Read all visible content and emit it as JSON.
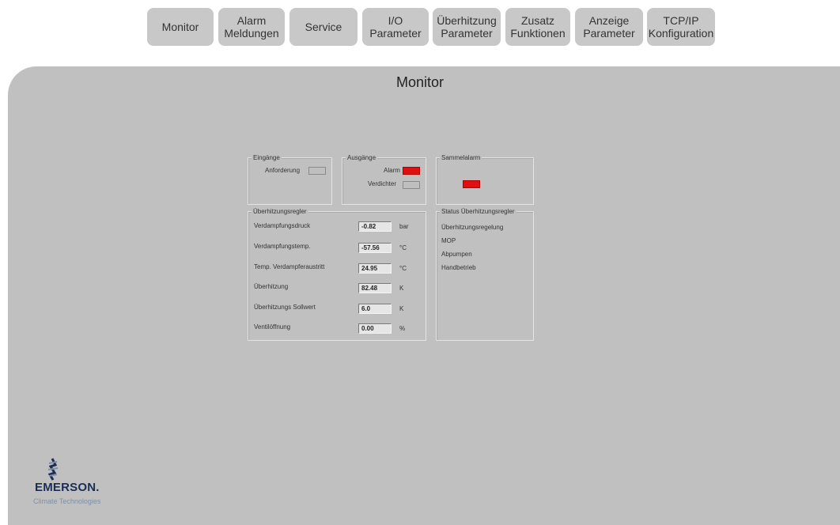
{
  "tabs": [
    {
      "label": "Monitor"
    },
    {
      "label": "Alarm\nMeldungen"
    },
    {
      "label": "Service"
    },
    {
      "label": "I/O\nParameter"
    },
    {
      "label": "Überhitzung\nParameter"
    },
    {
      "label": "Zusatz\nFunktionen"
    },
    {
      "label": "Anzeige\nParameter"
    },
    {
      "label": "TCP/IP\nKonfiguration"
    }
  ],
  "page": {
    "title": "Monitor"
  },
  "eingaenge": {
    "title": "Eingänge",
    "anforderung_label": "Anforderung",
    "anforderung_active": false
  },
  "ausgaenge": {
    "title": "Ausgänge",
    "alarm_label": "Alarm",
    "alarm_active": true,
    "verdichter_label": "Verdichter",
    "verdichter_active": false
  },
  "sammelalarm": {
    "title": "Sammelalarm",
    "active": true
  },
  "regler": {
    "title": "Überhitzungsregler",
    "rows": [
      {
        "label": "Verdampfungsdruck",
        "value": "-0.82",
        "unit": "bar"
      },
      {
        "label": "Verdampfungstemp.",
        "value": "-57.56",
        "unit": "°C"
      },
      {
        "label": "Temp. Verdampferaustritt",
        "value": "24.95",
        "unit": "°C"
      },
      {
        "label": "Überhitzung",
        "value": "82.48",
        "unit": "K"
      },
      {
        "label": "Überhitzungs Sollwert",
        "value": "6.0",
        "unit": "K"
      },
      {
        "label": "Ventilöffnung",
        "value": "0.00",
        "unit": "%"
      }
    ]
  },
  "status": {
    "title": "Status Überhitzungsregler",
    "items": [
      "Überhitzungsregelung",
      "MOP",
      "Abpumpen",
      "Handbetrieb"
    ]
  },
  "logo": {
    "name": "EMERSON.",
    "tagline": "Climate Technologies"
  },
  "colors": {
    "alarm_on": "#e01010",
    "panel": "#c0c0c0",
    "tab": "#c8c8c8"
  }
}
